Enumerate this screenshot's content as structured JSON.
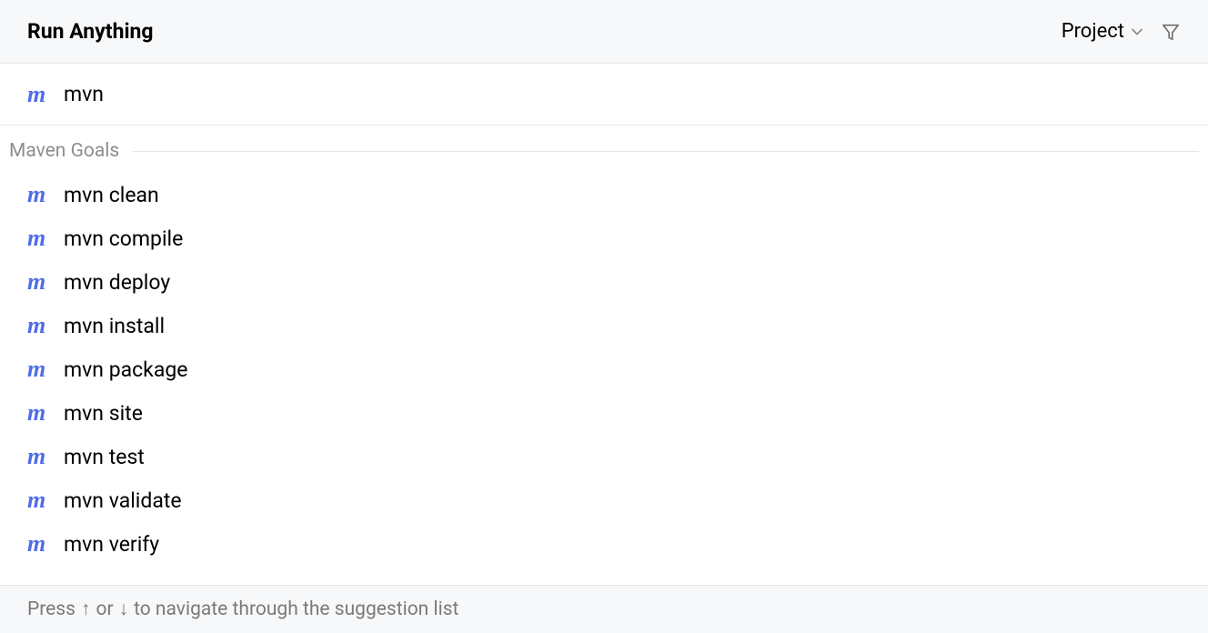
{
  "header": {
    "title": "Run Anything",
    "scope_label": "Project"
  },
  "search": {
    "value": "mvn"
  },
  "section": {
    "label": "Maven Goals"
  },
  "results": [
    {
      "label": "mvn clean"
    },
    {
      "label": "mvn compile"
    },
    {
      "label": "mvn deploy"
    },
    {
      "label": "mvn install"
    },
    {
      "label": "mvn package"
    },
    {
      "label": "mvn site"
    },
    {
      "label": "mvn test"
    },
    {
      "label": "mvn validate"
    },
    {
      "label": "mvn verify"
    }
  ],
  "footer": {
    "prefix": "Press ",
    "up": "↑",
    "mid": " or ",
    "down": "↓",
    "suffix": " to navigate through the suggestion list"
  },
  "icons": {
    "maven": "m"
  }
}
